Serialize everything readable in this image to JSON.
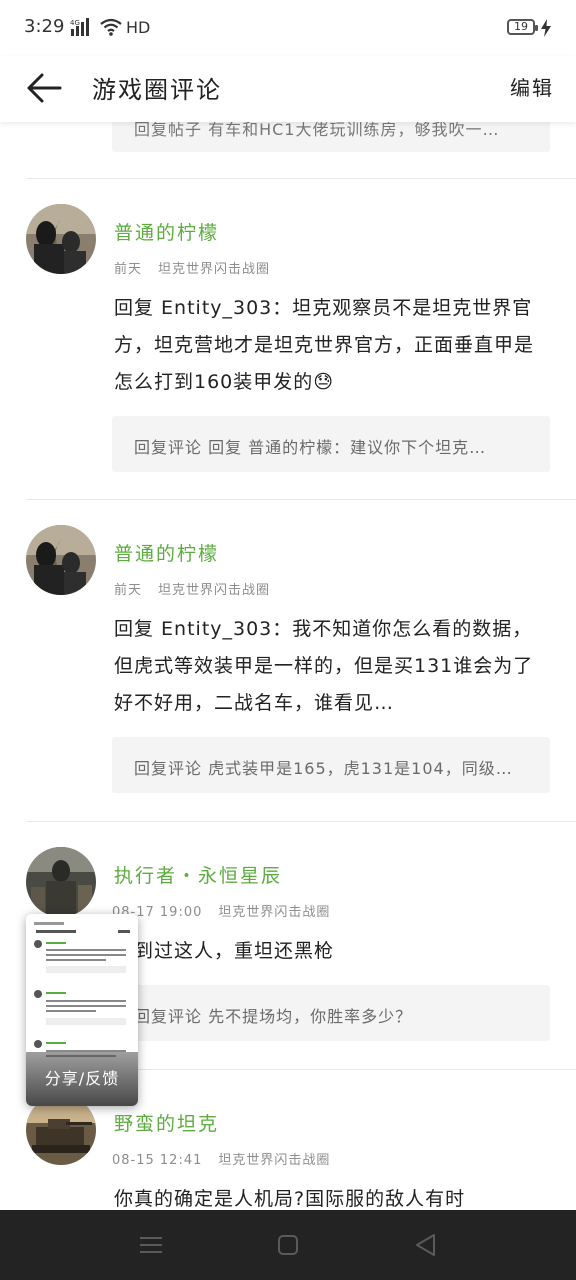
{
  "status_bar": {
    "time": "3:29",
    "network": "4G",
    "hd": "HD",
    "battery": "19"
  },
  "header": {
    "title": "游戏圈评论",
    "edit": "编辑"
  },
  "top_reply_text": "回复帖子 有车和HC1大佬玩训练房，够我吹一…",
  "posts": [
    {
      "username": "普通的柠檬",
      "time": "前天",
      "circle": "坦克世界闪击战圈",
      "content": "回复 Entity_303：坦克观察员不是坦克世界官方，坦克营地才是坦克世界官方，正面垂直甲是怎么打到160装甲发的",
      "emoji": "😓",
      "reply": "回复评论 回复 普通的柠檬：建议你下个坦克…"
    },
    {
      "username": "普通的柠檬",
      "time": "前天",
      "circle": "坦克世界闪击战圈",
      "content": "回复 Entity_303：我不知道你怎么看的数据，但虎式等效装甲是一样的，但是买131谁会为了好不好用，二战名车，谁看见…",
      "reply": "回复评论 虎式装甲是165，虎131是104，同级…"
    },
    {
      "username": "执行者・永恒星辰",
      "time": "08-17 19:00",
      "circle": "坦克世界闪击战圈",
      "content": "遇到过这人，重坦还黑枪",
      "reply": "回复评论 先不提场均，你胜率多少？"
    },
    {
      "username": "野蛮的坦克",
      "time": "08-15 12:41",
      "circle": "坦克世界闪击战圈",
      "content": "你真的确定是人机局?国际服的敌人有时"
    }
  ],
  "float_card": {
    "button": "分享/反馈"
  },
  "colors": {
    "username_green": "#5cac3f",
    "nav_bar": "#232323",
    "reply_bg": "#f4f4f4"
  }
}
